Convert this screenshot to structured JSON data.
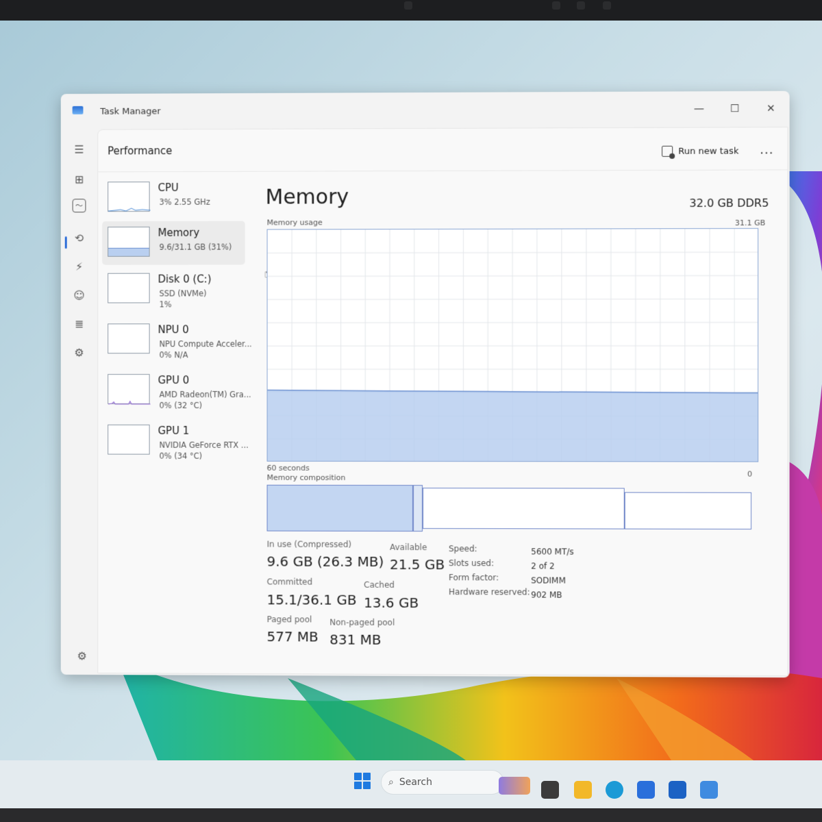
{
  "window": {
    "title": "Task Manager"
  },
  "header": {
    "page_title": "Performance",
    "run_new_task": "Run new task",
    "more": "..."
  },
  "perf_items": [
    {
      "name": "CPU",
      "sub": "3%  2.55 GHz",
      "sub2": ""
    },
    {
      "name": "Memory",
      "sub": "9.6/31.1 GB (31%)",
      "sub2": ""
    },
    {
      "name": "Disk 0 (C:)",
      "sub": "SSD (NVMe)",
      "sub2": "1%"
    },
    {
      "name": "NPU 0",
      "sub": "NPU Compute Acceler...",
      "sub2": "0%  N/A"
    },
    {
      "name": "GPU 0",
      "sub": "AMD Radeon(TM) Gra...",
      "sub2": "0%  (32 °C)"
    },
    {
      "name": "GPU 1",
      "sub": "NVIDIA GeForce RTX ...",
      "sub2": "0%  (34 °C)"
    }
  ],
  "detail": {
    "title": "Memory",
    "total": "32.0 GB DDR5",
    "usage_label": "Memory usage",
    "usage_max": "31.1 GB",
    "time_label": "60 seconds",
    "zero_label": "0",
    "composition_label": "Memory composition",
    "usage_fraction": 0.31
  },
  "stats": {
    "in_use_label": "In use (Compressed)",
    "in_use_value": "9.6 GB (26.3 MB)",
    "available_label": "Available",
    "available_value": "21.5 GB",
    "committed_label": "Committed",
    "committed_value": "15.1/36.1 GB",
    "cached_label": "Cached",
    "cached_value": "13.6 GB",
    "paged_label": "Paged pool",
    "paged_value": "577 MB",
    "nonpaged_label": "Non-paged pool",
    "nonpaged_value": "831 MB"
  },
  "specs": [
    {
      "label": "Speed:",
      "value": "5600 MT/s"
    },
    {
      "label": "Slots used:",
      "value": "2 of 2"
    },
    {
      "label": "Form factor:",
      "value": "SODIMM"
    },
    {
      "label": "Hardware reserved:",
      "value": "902 MB"
    }
  ],
  "taskbar": {
    "search_placeholder": "Search"
  },
  "colors": {
    "accent": "#2d6dd8",
    "memory_fill": "#b9cff0",
    "memory_line": "#6a8fd0"
  }
}
